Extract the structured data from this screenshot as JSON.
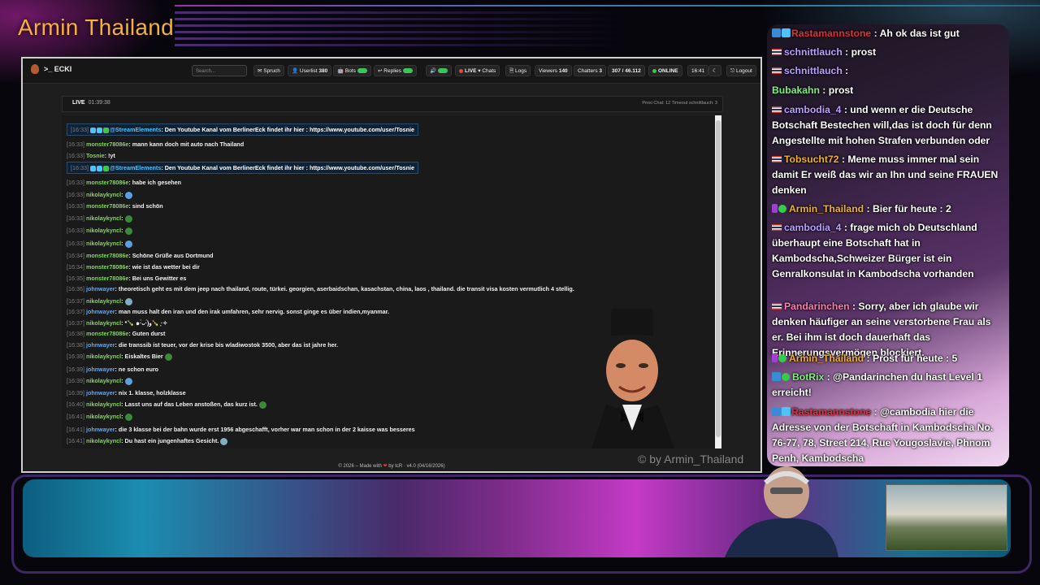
{
  "overlay": {
    "channel_title": "Armin Thailand",
    "watermark": "© by Armin_Thailand"
  },
  "topbar": {
    "brand": ">_ ECKI",
    "search_placeholder": "Search...",
    "spruch_label": "Spruch",
    "userlist_label": "Userlist",
    "userlist_count": "380",
    "bots_label": "Bots",
    "replies_label": "Replies",
    "live_label": "LIVE",
    "chats_label": "Chats",
    "logs_label": "Logs",
    "viewers_label": "Viewers",
    "viewers_count": "140",
    "chatters_label": "Chatters",
    "chatters_count": "3",
    "followers": "307 / 46.112",
    "online_label": "ONLINE",
    "clock": "16:41",
    "logout_label": "Logout"
  },
  "livebar": {
    "live": "LIVE",
    "uptime": "01:39:38",
    "right_text": "Proxi Chat: 12 Timeout schnittlauch: 3"
  },
  "chat": {
    "messages": [
      {
        "time": "[16:33]",
        "user": "@StreamElements",
        "text": ": Den Youtube Kanal vom BerlinerEck findet ihr hier : https://www.youtube.com/user/Tosnie",
        "highlight": true,
        "ucolor": "#4fc3f7",
        "tcolor": "#ffffff"
      },
      {
        "time": "[16:33]",
        "user": "monster78086e",
        "text": ": mann kann doch mit auto nach Thailand",
        "ucolor": "#7ed957"
      },
      {
        "time": "[16:33]",
        "user": "Tosnie",
        "text": ": !yt",
        "ucolor": "#7ed957"
      },
      {
        "time": "[16:33]",
        "user": "@StreamElements",
        "text": ": Den Youtube Kanal vom BerlinerEck findet ihr hier : https://www.youtube.com/user/Tosnie",
        "highlight": true,
        "ucolor": "#4fc3f7",
        "tcolor": "#ffffff"
      },
      {
        "time": "[16:33]",
        "user": "monster78086e",
        "text": ": habe ich gesehen",
        "ucolor": "#7ed957"
      },
      {
        "time": "[16:33]",
        "user": "nikolaykyncl",
        "text": ":",
        "ucolor": "#7ed957"
      },
      {
        "time": "[16:33]",
        "user": "monster78086e",
        "text": ": sind schön",
        "ucolor": "#7ed957"
      },
      {
        "time": "[16:33]",
        "user": "nikolaykyncl",
        "text": ":",
        "ucolor": "#7ed957"
      },
      {
        "time": "[16:33]",
        "user": "nikolaykyncl",
        "text": ":",
        "ucolor": "#7ed957"
      },
      {
        "time": "[16:33]",
        "user": "nikolaykyncl",
        "text": ":",
        "ucolor": "#7ed957"
      },
      {
        "time": "[16:34]",
        "user": "monster78086e",
        "text": ": Schöne Grüße aus Dortmund",
        "ucolor": "#7ed957"
      },
      {
        "time": "[16:34]",
        "user": "monster78086e",
        "text": ": wie ist das wetter bei dir",
        "ucolor": "#7ed957"
      },
      {
        "time": "[16:35]",
        "user": "monster78086e",
        "text": ": Bei uns Gewitter es",
        "ucolor": "#7ed957"
      },
      {
        "time": "[16:36]",
        "user": "johnwayer",
        "text": ": theoretisch geht es mit dem jeep nach thailand, route, türkei. georgien, aserbaidschan, kasachstan, china, laos , thailand. die transit visa kosten vermutlich 4 stellig.",
        "ucolor": "#5aa9ff"
      },
      {
        "time": "[16:37]",
        "user": "nikolaykyncl",
        "text": ":",
        "ucolor": "#7ed957"
      },
      {
        "time": "[16:37]",
        "user": "johnwayer",
        "text": ": man muss halt den iran und den irak umfahren, sehr nervig. sonst ginge es über indien,myanmar.",
        "ucolor": "#5aa9ff"
      },
      {
        "time": "[16:37]",
        "user": "nikolaykyncl",
        "text": ": *🍾 ๑·̀ᴗ·́)و🍾 ·̩͙✧",
        "ucolor": "#7ed957"
      },
      {
        "time": "[16:38]",
        "user": "monster78086e",
        "text": ": Guten durst",
        "ucolor": "#7ed957"
      },
      {
        "time": "[16:38]",
        "user": "johnwayer",
        "text": ": die transsib ist teuer, vor der krise bis wladiwostok 3500, aber das ist jahre her.",
        "ucolor": "#5aa9ff"
      },
      {
        "time": "[16:39]",
        "user": "nikolaykyncl",
        "text": ": Eiskaltes Bier",
        "ucolor": "#7ed957"
      },
      {
        "time": "[16:39]",
        "user": "johnwayer",
        "text": ": ne schon euro",
        "ucolor": "#5aa9ff"
      },
      {
        "time": "[16:39]",
        "user": "nikolaykyncl",
        "text": ":",
        "ucolor": "#7ed957"
      },
      {
        "time": "[16:39]",
        "user": "johnwayer",
        "text": ": nix 1. klasse, holzklasse",
        "ucolor": "#5aa9ff"
      },
      {
        "time": "[16:40]",
        "user": "nikolaykyncl",
        "text": ": Lasst uns auf das Leben anstoßen, das kurz ist.",
        "ucolor": "#7ed957"
      },
      {
        "time": "[16:41]",
        "user": "nikolaykyncl",
        "text": ":",
        "ucolor": "#7ed957"
      },
      {
        "time": "[16:41]",
        "user": "johnwayer",
        "text": ": die 3 klasse bei der bahn wurde erst 1956 abgeschafft, vorher war man schon in der 2 kaisse was besseres",
        "ucolor": "#5aa9ff"
      },
      {
        "time": "[16:41]",
        "user": "nikolaykyncl",
        "text": ": Du hast ein jungenhaftes Gesicht.",
        "ucolor": "#7ed957"
      }
    ]
  },
  "footer": {
    "text_before": "© 2026 – Made with",
    "text_after": "by tcR · v4.0 (04/16/2026)"
  },
  "side_chat": {
    "messages": [
      {
        "user": "Rastamannstone",
        "text": " : Ah ok das ist gut",
        "ucolor": "#e0303a"
      },
      {
        "user": "schnittlauch",
        "text": " : prost",
        "ucolor": "#b8a0ff"
      },
      {
        "user": "schnittlauch",
        "text": " :",
        "ucolor": "#b8a0ff"
      },
      {
        "user": "Bubakahn",
        "text": " : prost",
        "ucolor": "#7ef07e"
      },
      {
        "user": "cambodia_4",
        "text": " : und wenn er die Deutsche Botschaft Bestechen will,das ist doch für denn Angestellte mit hohen Strafen verbunden oder",
        "ucolor": "#b8a0ff"
      },
      {
        "user": "Tobsucht72",
        "text": " : Meme muss immer mal sein damit Er weiß das wir an Ihn und seine FRAUEN denken",
        "ucolor": "#f0b030"
      },
      {
        "user": "Armin_Thailand",
        "text": " : Bier für heute : 2",
        "ucolor": "#f0b030"
      },
      {
        "user": "cambodia_4",
        "text": " : frage mich ob Deutschland überhaupt eine Botschaft hat in Kambodscha,Schweizer Bürger ist ein Genralkonsulat in Kambodscha vorhanden",
        "ucolor": "#b8a0ff"
      },
      {
        "user": "Pandarinchen",
        "text": " : Sorry, aber ich glaube wir denken häufiger an seine verstorbene Frau als er. Bei ihm ist doch dauerhaft das Erinnerungsvermögen blockiert.",
        "ucolor": "#ff7ab0"
      },
      {
        "user": "Armin_Thailand",
        "text": " : Prost für heute : 5",
        "ucolor": "#f0b030"
      },
      {
        "user": "BotRix",
        "text": " : @Pandarinchen du hast Level 1 erreicht!",
        "ucolor": "#7ef07e"
      },
      {
        "user": "Rastamannstone",
        "text": " : @cambodia hier die Adresse von der Botschaft in Kambodscha No. 76-77, 78, Street 214, Rue Yougoslavie, Phnom Penh, Kambodscha",
        "ucolor": "#e0303a"
      }
    ]
  },
  "colors": {
    "accent_gold": "#f5b040",
    "chat_bg": "#1a1a1a",
    "toggle_green": "#3cc45a"
  }
}
